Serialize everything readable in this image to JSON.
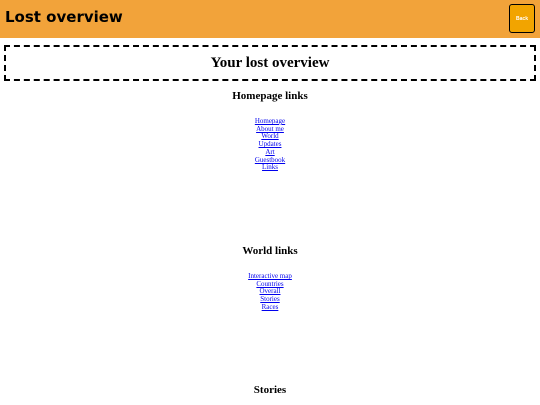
{
  "header": {
    "title": "Lost overview",
    "back_label": "Back"
  },
  "page": {
    "title": "Your lost overview"
  },
  "sections": [
    {
      "heading": "Homepage links",
      "links": [
        "Homepage",
        "About me",
        "World",
        "Updates",
        "Art",
        "Guestbook",
        "Links"
      ]
    },
    {
      "heading": "World links",
      "links": [
        "Interactive map",
        "Countries",
        "Overall",
        "Stories",
        "Races"
      ]
    },
    {
      "heading": "Stories",
      "links": []
    }
  ],
  "colors": {
    "header_bg": "#f2a33a",
    "button_bg": "#f2a400",
    "link": "#0000ee"
  }
}
